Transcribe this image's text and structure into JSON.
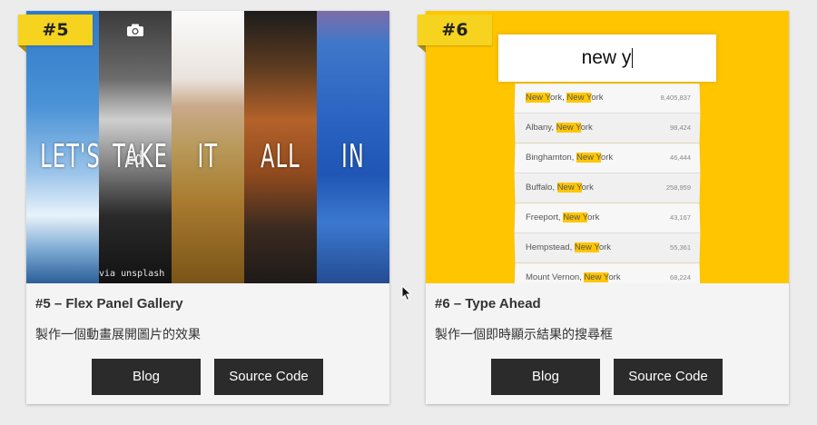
{
  "cards": [
    {
      "badge": "#5",
      "title": "#5 – Flex Panel Gallery",
      "description": "製作一個動畫展開圖片的效果",
      "buttons": {
        "blog": "Blog",
        "source": "Source Code"
      },
      "preview": {
        "panel_words": [
          "LET'S",
          "TAKE",
          "IT",
          "ALL",
          "IN"
        ],
        "overlay_word": "Ed",
        "watermark": "via unsplash",
        "icon": "camera-icon"
      }
    },
    {
      "badge": "#6",
      "title": "#6 – Type Ahead",
      "description": "製作一個即時顯示結果的搜尋框",
      "buttons": {
        "blog": "Blog",
        "source": "Source Code"
      },
      "preview": {
        "search_value": "new y",
        "results": [
          {
            "pre": "",
            "hl1": "New Y",
            "mid": "ork, ",
            "hl2": "New Y",
            "post": "ork",
            "population": "8,405,837"
          },
          {
            "pre": "Albany, ",
            "hl1": "New Y",
            "mid": "ork",
            "hl2": "",
            "post": "",
            "population": "98,424"
          },
          {
            "pre": "Binghamton, ",
            "hl1": "New Y",
            "mid": "ork",
            "hl2": "",
            "post": "",
            "population": "46,444"
          },
          {
            "pre": "Buffalo, ",
            "hl1": "New Y",
            "mid": "ork",
            "hl2": "",
            "post": "",
            "population": "258,959"
          },
          {
            "pre": "Freeport, ",
            "hl1": "New Y",
            "mid": "ork",
            "hl2": "",
            "post": "",
            "population": "43,167"
          },
          {
            "pre": "Hempstead, ",
            "hl1": "New Y",
            "mid": "ork",
            "hl2": "",
            "post": "",
            "population": "55,361"
          },
          {
            "pre": "Mount Vernon, ",
            "hl1": "New Y",
            "mid": "ork",
            "hl2": "",
            "post": "",
            "population": "68,224"
          }
        ]
      }
    }
  ],
  "colors": {
    "accent": "#f5d31e",
    "typeahead_bg": "#ffc600",
    "button_bg": "#2b2b2b"
  }
}
